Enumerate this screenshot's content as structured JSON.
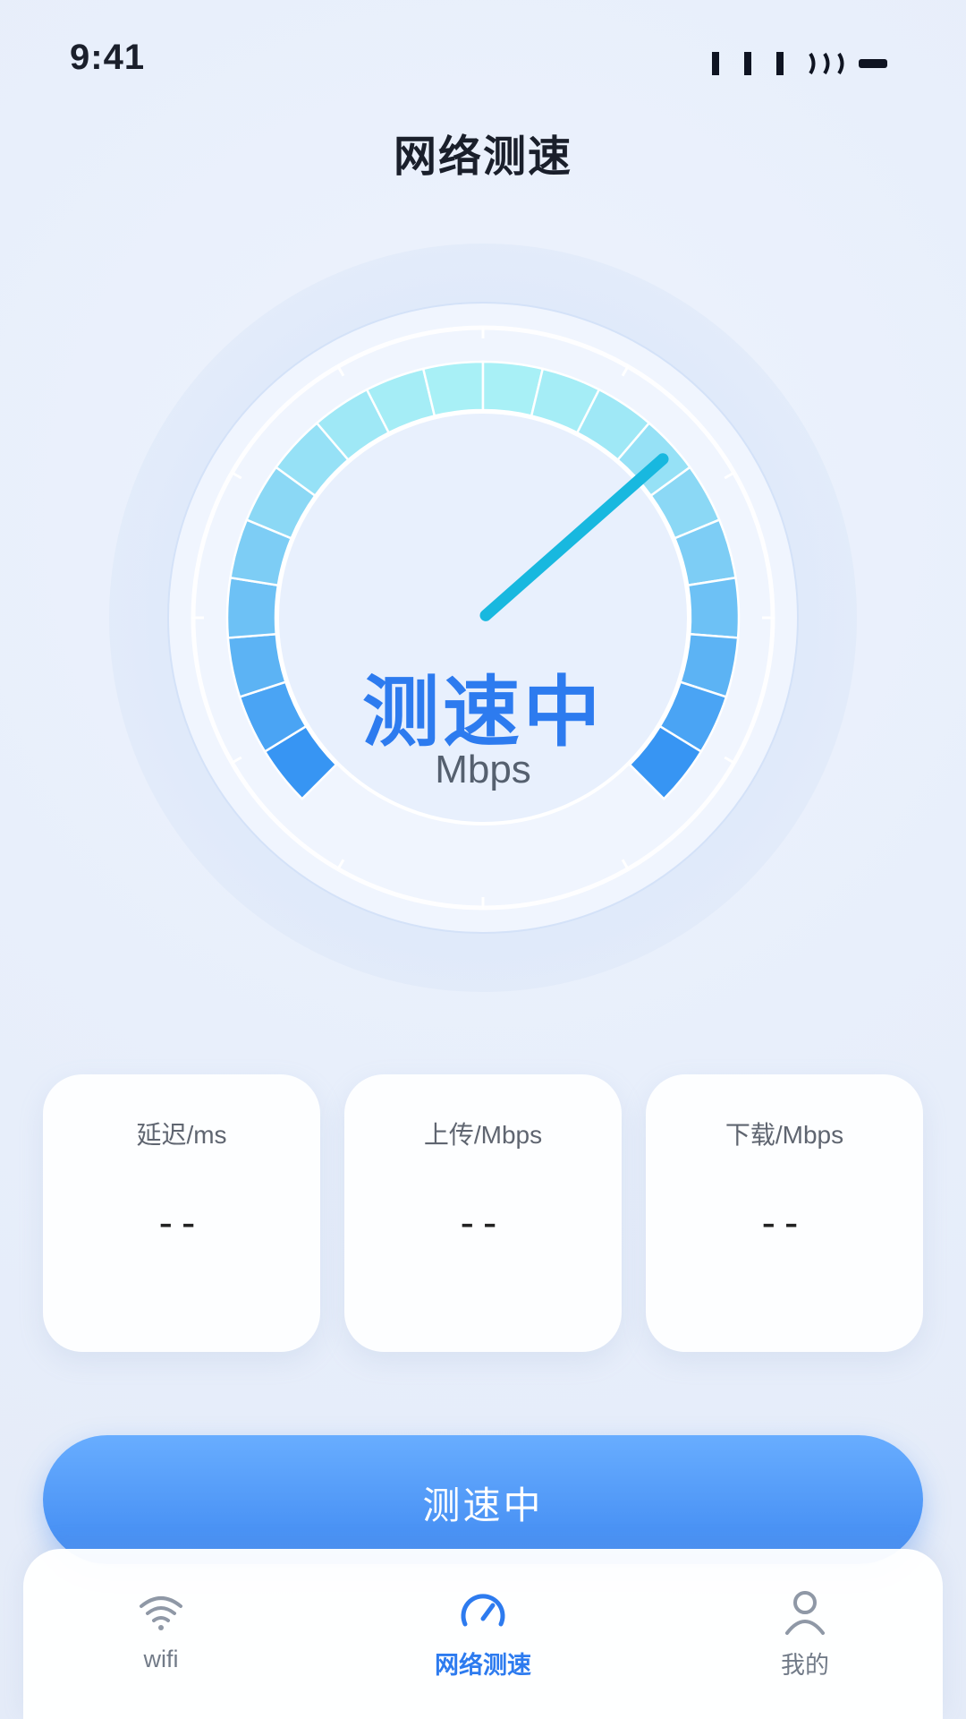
{
  "status_bar": {
    "time": "9:41"
  },
  "header": {
    "title": "网络测速"
  },
  "gauge": {
    "status": "测速中",
    "unit": "Mbps",
    "needle_fraction": 0.68
  },
  "metrics": [
    {
      "label": "延迟/ms",
      "value": "--"
    },
    {
      "label": "上传/Mbps",
      "value": "--"
    },
    {
      "label": "下载/Mbps",
      "value": "--"
    }
  ],
  "action_button": {
    "label": "测速中"
  },
  "tabs": [
    {
      "label": "wifi",
      "icon": "wifi-icon",
      "active": false
    },
    {
      "label": "网络测速",
      "icon": "speedometer-icon",
      "active": true
    },
    {
      "label": "我的",
      "icon": "user-icon",
      "active": false
    }
  ],
  "colors": {
    "accent": "#2d7bef",
    "gauge_start": "#2d8df3",
    "gauge_end": "#a8f0f6",
    "needle": "#18b8df"
  }
}
